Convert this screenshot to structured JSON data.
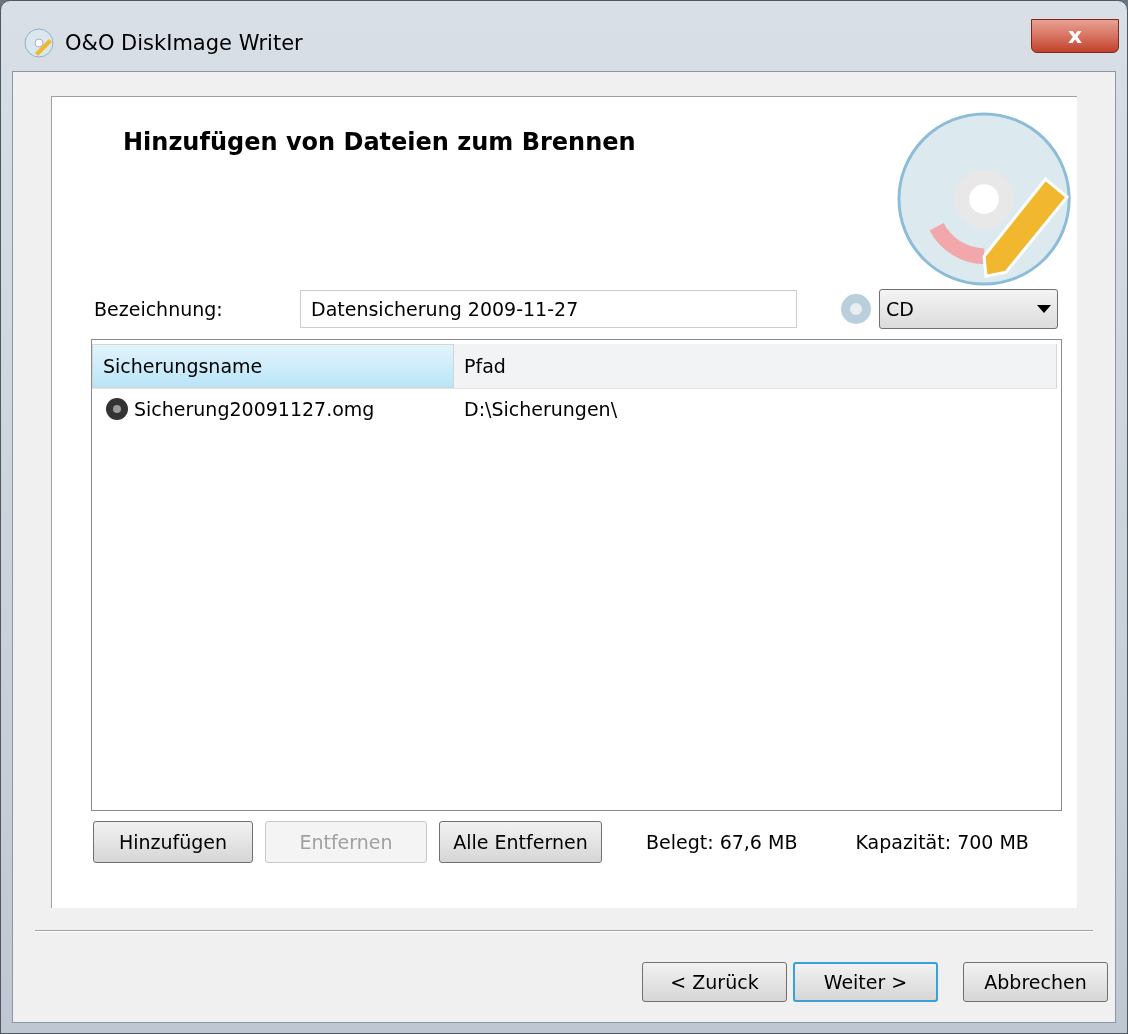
{
  "window": {
    "title": "O&O DiskImage Writer",
    "close": "x"
  },
  "heading": "Hinzufügen von Dateien zum Brennen",
  "label_field": {
    "label": "Bezeichnung:",
    "value": "Datensicherung 2009-11-27"
  },
  "media_select": {
    "value": "CD"
  },
  "table": {
    "columns": [
      {
        "label": "Sicherungsname",
        "selected": true
      },
      {
        "label": "Pfad",
        "selected": false
      }
    ],
    "rows": [
      {
        "name": "Sicherung20091127.omg",
        "path": "D:\\Sicherungen\\"
      }
    ]
  },
  "list_buttons": [
    {
      "label": "Hinzufügen",
      "disabled": false
    },
    {
      "label": "Entfernen",
      "disabled": true
    },
    {
      "label": "Alle Entfernen",
      "disabled": false
    }
  ],
  "used": "Belegt: 67,6 MB",
  "capacity": "Kapazität: 700 MB",
  "nav_buttons": [
    {
      "label": "< Zurück",
      "default": false
    },
    {
      "label": "Weiter >",
      "default": true
    },
    {
      "label": "Abbrechen",
      "default": false
    }
  ]
}
